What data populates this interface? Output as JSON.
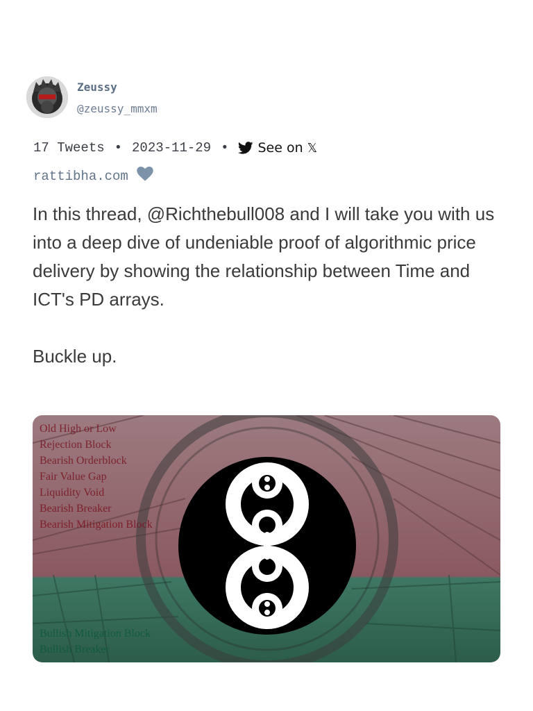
{
  "author": {
    "display_name": "Zeussy",
    "handle": "@zeussy_mmxm",
    "avatar": "profile-avatar"
  },
  "meta": {
    "tweets_count": "17 Tweets",
    "date": "2023-11-29",
    "separator": "•",
    "see_on_label": "See on",
    "see_on_platform": "𝕏",
    "source": "rattibha.com"
  },
  "tweet": {
    "paragraph_1": "In this thread, @Richthebull008  and I will take you with us into a deep dive of undeniable proof of algorithmic price delivery by showing the relationship between Time and ICT's PD arrays.",
    "paragraph_2": "Buckle up."
  },
  "media": {
    "bearish_labels": [
      "Old High or Low",
      "Rejection Block",
      "Bearish Orderblock",
      "Fair Value Gap",
      "Liquidity Void",
      "Bearish Breaker",
      "Bearish Mitigation Block"
    ],
    "bullish_labels": [
      "Bullish Mitigation Block",
      "Bullish Breaker"
    ],
    "colors": {
      "bearish_tint": "#8a5960",
      "bullish_tint": "#2f6b56",
      "bearish_text": "#7a1420",
      "bullish_text": "#0e5a3c"
    }
  }
}
